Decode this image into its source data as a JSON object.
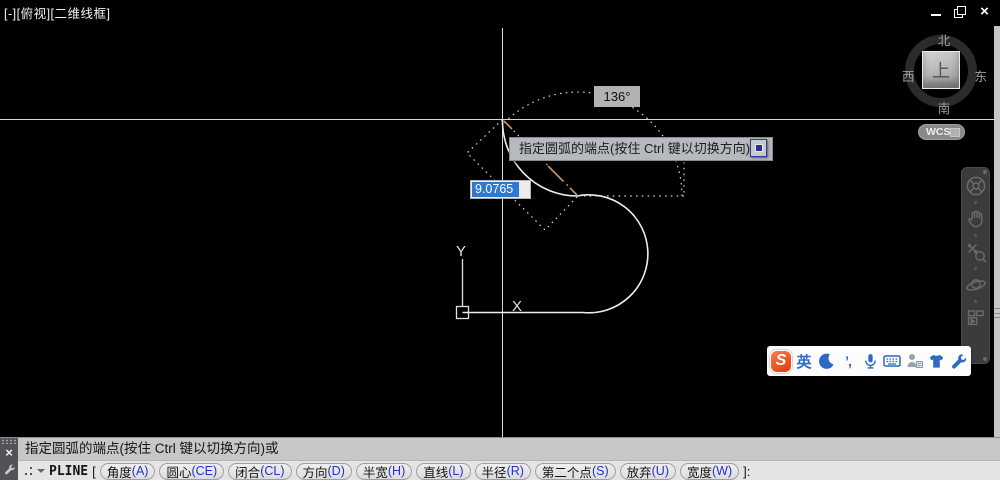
{
  "title_bar": {
    "viewport_label": "[-][俯视][二维线框]",
    "close_glyph": "×"
  },
  "viewcube": {
    "north": "北",
    "south": "南",
    "west": "西",
    "east": "东",
    "top_face": "上"
  },
  "wcs_badge": {
    "label": "WCS"
  },
  "drawing": {
    "angle_badge": "136°",
    "distance_value": "9.0765",
    "tooltip_prompt": "指定圆弧的端点(按住 Ctrl 键以切换方向)或",
    "ucs": {
      "x_label": "X",
      "y_label": "Y"
    }
  },
  "ime_toolbar": {
    "logo_letter": "S",
    "mode_label": "英",
    "punctuation_glyph": "’,"
  },
  "command_dock": {
    "close_glyph": "×",
    "history_line": "指定圆弧的端点(按住 Ctrl 键以切换方向)或",
    "command_name": "PLINE",
    "bracket_open": "[",
    "bracket_close": "]:",
    "options": [
      {
        "label": "角度",
        "key": "(A)"
      },
      {
        "label": "圆心",
        "key": "(CE)"
      },
      {
        "label": "闭合",
        "key": "(CL)"
      },
      {
        "label": "方向",
        "key": "(D)"
      },
      {
        "label": "半宽",
        "key": "(H)"
      },
      {
        "label": "直线",
        "key": "(L)"
      },
      {
        "label": "半径",
        "key": "(R)"
      },
      {
        "label": "第二个点",
        "key": "(S)"
      },
      {
        "label": "放弃",
        "key": "(U)"
      },
      {
        "label": "宽度",
        "key": "(W)"
      }
    ]
  },
  "colors": {
    "selection_blue": "#2e79d0",
    "tracking_orange": "#c9974d",
    "ime_blue": "#2b6bc4",
    "sogou_red": "#dd3a10",
    "crosshair_white": "#d9d9d9"
  }
}
